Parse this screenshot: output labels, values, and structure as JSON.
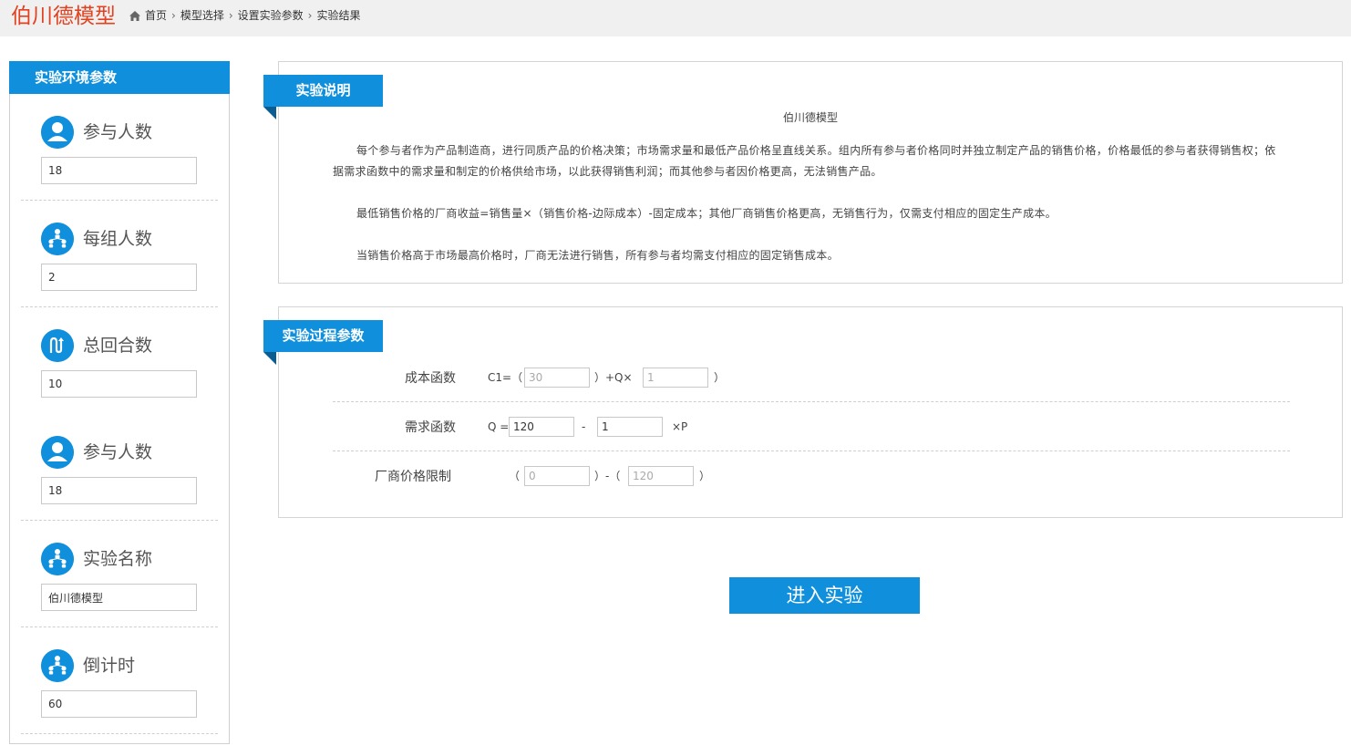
{
  "header": {
    "title": "伯川德模型",
    "breadcrumb": [
      "首页",
      "模型选择",
      "设置实验参数",
      "实验结果"
    ]
  },
  "sidebar": {
    "title": "实验环境参数",
    "params": [
      {
        "label": "参与人数",
        "value": "18",
        "icon": "user-icon"
      },
      {
        "label": "每组人数",
        "value": "2",
        "icon": "group-icon"
      },
      {
        "label": "总回合数",
        "value": "10",
        "icon": "rounds-icon"
      },
      {
        "label": "参与人数",
        "value": "18",
        "icon": "user-icon"
      },
      {
        "label": "实验名称",
        "value": "伯川德模型",
        "icon": "group-icon"
      },
      {
        "label": "倒计时",
        "value": "60",
        "icon": "group-icon"
      }
    ]
  },
  "description": {
    "tag": "实验说明",
    "title": "伯川德模型",
    "paragraphs": [
      "每个参与者作为产品制造商，进行同质产品的价格决策；市场需求量和最低产品价格呈直线关系。组内所有参与者价格同时并独立制定产品的销售价格，价格最低的参与者获得销售权；依据需求函数中的需求量和制定的价格供给市场，以此获得销售利润；而其他参与者因价格更高，无法销售产品。",
      "最低销售价格的厂商收益=销售量×（销售价格-边际成本）-固定成本；其他厂商销售价格更高，无销售行为，仅需支付相应的固定生产成本。",
      "当销售价格高于市场最高价格时，厂商无法进行销售，所有参与者均需支付相应的固定销售成本。"
    ]
  },
  "process": {
    "tag": "实验过程参数",
    "cost": {
      "label": "成本函数",
      "prefix": "C1=（",
      "fixed": "30",
      "mid": "）+Q×",
      "marginal": "1",
      "suffix": "）"
    },
    "demand": {
      "label": "需求函数",
      "prefix": "Q =",
      "intercept": "120",
      "minus": "-",
      "slope": "1",
      "suffix": "×P"
    },
    "limit": {
      "label": "厂商价格限制",
      "open": "（",
      "min": "0",
      "mid": "）-（",
      "max": "120",
      "close": "）"
    }
  },
  "actions": {
    "enter": "进入实验"
  },
  "colors": {
    "accent": "#1090dc",
    "title": "#e2421f"
  }
}
